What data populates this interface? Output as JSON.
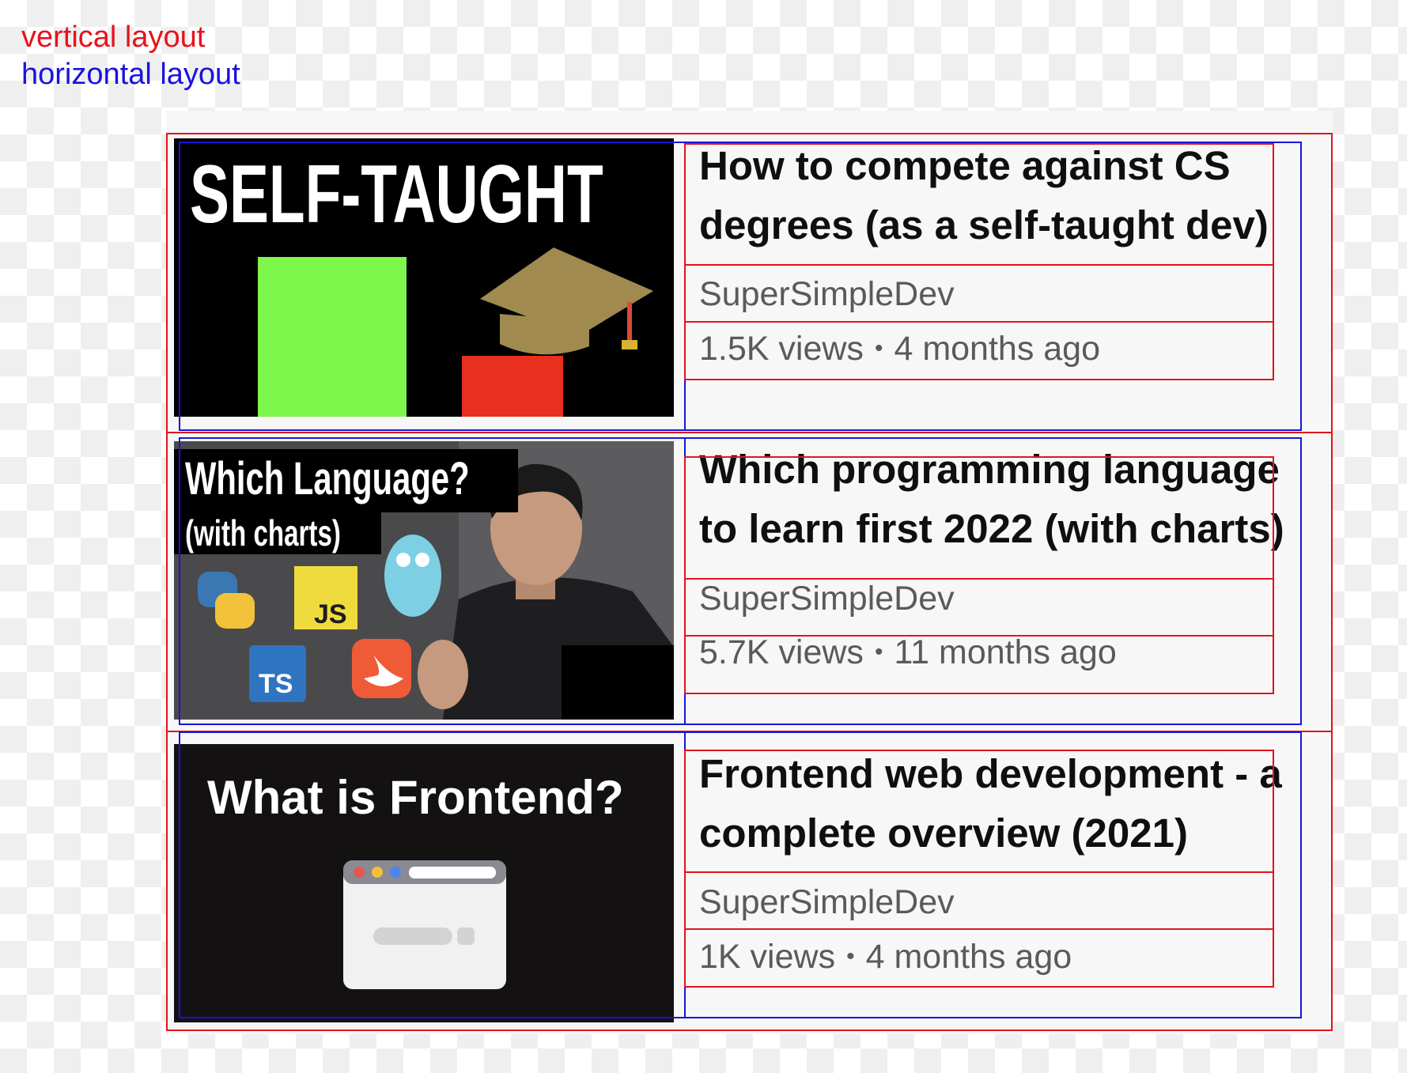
{
  "legend": {
    "vertical_label": "vertical layout",
    "horizontal_label": "horizontal layout",
    "vertical_color": "#e2141c",
    "horizontal_color": "#1815d8"
  },
  "videos": [
    {
      "title_line1": "How to compete against CS",
      "title_line2": "degrees (as a self-taught dev)",
      "channel": "SuperSimpleDev",
      "views": "1.5K views",
      "separator": "•",
      "age": "4 months ago",
      "thumbnail": {
        "headline": "SELF-TAUGHT",
        "icons": [
          "green-block-icon",
          "graduation-cap-icon",
          "red-block-icon"
        ]
      }
    },
    {
      "title_line1": "Which programming language",
      "title_line2": "to learn first 2022 (with charts)",
      "channel": "SuperSimpleDev",
      "views": "5.7K views",
      "separator": "•",
      "age": "11 months ago",
      "thumbnail": {
        "headline": "Which Language?",
        "subheadline": "(with charts)",
        "badges": [
          "JS",
          "TS"
        ],
        "icons": [
          "python-logo-icon",
          "js-logo-icon",
          "go-gopher-icon",
          "ts-logo-icon",
          "swift-logo-icon",
          "presenter-photo"
        ]
      }
    },
    {
      "title_line1": "Frontend web development - a",
      "title_line2": "complete overview (2021)",
      "channel": "SuperSimpleDev",
      "views": "1K views",
      "separator": "•",
      "age": "4 months ago",
      "thumbnail": {
        "headline": "What is Frontend?",
        "icons": [
          "browser-window-icon"
        ]
      }
    }
  ]
}
